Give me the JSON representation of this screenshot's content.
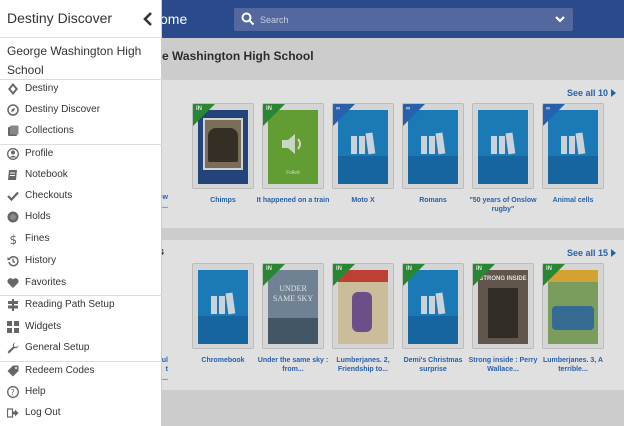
{
  "topbar": {
    "home_text": "ome",
    "search_placeholder": "Search"
  },
  "main": {
    "school_title_fragment": "e Washington High School",
    "shelves": [
      {
        "title": "",
        "see_all": "See all 10",
        "books": [
          {
            "caption": ": how\n..."
          },
          {
            "caption": "Chimps",
            "badge": "IN"
          },
          {
            "caption": "It happened on a train",
            "badge": "IN",
            "cover_text": "Follett"
          },
          {
            "caption": "Moto X",
            "badge": "∞"
          },
          {
            "caption": "Romans",
            "badge": "∞"
          },
          {
            "caption": "\"50 years of Onslow rugby\""
          },
          {
            "caption": "Animal cells",
            "badge": "∞"
          }
        ]
      },
      {
        "title": "s",
        "see_all": "See all 15",
        "books": [
          {
            "caption": "ul\nt\n..."
          },
          {
            "caption": "Chromebook"
          },
          {
            "caption": "Under the same sky : from...",
            "badge": "IN",
            "cover_text": "UNDER SAME SKY"
          },
          {
            "caption": "Lumberjanes. 2, Friendship to...",
            "badge": "IN"
          },
          {
            "caption": "Demi's Christmas surprise",
            "badge": "IN"
          },
          {
            "caption": "Strong inside : Perry Wallace...",
            "badge": "IN",
            "cover_text": "STRONG INSIDE"
          },
          {
            "caption": "Lumberjanes. 3, A terrible...",
            "badge": "IN"
          }
        ]
      }
    ]
  },
  "drawer": {
    "title": "Destiny Discover",
    "school": "George Washington High School",
    "items": [
      {
        "label": "Destiny",
        "icon": "destiny-icon"
      },
      {
        "label": "Destiny Discover",
        "icon": "compass-icon"
      },
      {
        "label": "Collections",
        "icon": "collections-icon"
      },
      {
        "label": "Profile",
        "icon": "profile-icon"
      },
      {
        "label": "Notebook",
        "icon": "notebook-icon"
      },
      {
        "label": "Checkouts",
        "icon": "check-icon"
      },
      {
        "label": "Holds",
        "icon": "holds-icon"
      },
      {
        "label": "Fines",
        "icon": "dollar-icon"
      },
      {
        "label": "History",
        "icon": "history-icon"
      },
      {
        "label": "Favorites",
        "icon": "heart-icon"
      },
      {
        "label": "Reading Path Setup",
        "icon": "signpost-icon"
      },
      {
        "label": "Widgets",
        "icon": "widgets-icon"
      },
      {
        "label": "General Setup",
        "icon": "wrench-icon"
      },
      {
        "label": "Redeem Codes",
        "icon": "tag-icon"
      },
      {
        "label": "Help",
        "icon": "help-icon"
      },
      {
        "label": "Log Out",
        "icon": "logout-icon"
      }
    ]
  }
}
